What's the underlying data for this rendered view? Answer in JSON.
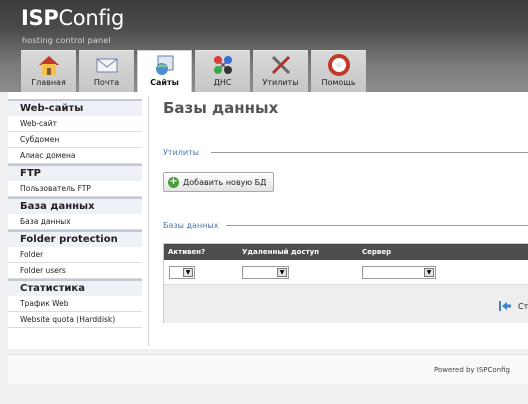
{
  "header": {
    "logo_isp": "ISP",
    "logo_config": "Config",
    "tagline": "hosting control panel"
  },
  "tabs": [
    {
      "label": "Главная",
      "icon": "home-icon"
    },
    {
      "label": "Почта",
      "icon": "mail-icon"
    },
    {
      "label": "Сайты",
      "icon": "sites-icon",
      "active": true
    },
    {
      "label": "ДНС",
      "icon": "dns-icon"
    },
    {
      "label": "Утилиты",
      "icon": "tools-icon"
    },
    {
      "label": "Помощь",
      "icon": "help-icon"
    }
  ],
  "sidebar": {
    "sections": [
      {
        "title": "Web-сайты",
        "items": [
          "Web-сайт",
          "Субдомен",
          "Алиас домена"
        ]
      },
      {
        "title": "FTP",
        "items": [
          "Пользователь FTP"
        ]
      },
      {
        "title": "База данных",
        "items": [
          "База данных"
        ]
      },
      {
        "title": "Folder protection",
        "items": [
          "Folder",
          "Folder users"
        ]
      },
      {
        "title": "Статистика",
        "items": [
          "Трафик Web",
          "Website quota (Harddisk)"
        ]
      }
    ]
  },
  "main": {
    "title": "Базы данных",
    "tools_legend": "Утилиты",
    "add_button": "Добавить новую БД",
    "list_legend": "Базы данных",
    "columns": [
      "Активен?",
      "Удаленный доступ",
      "Сервер"
    ],
    "pager_text": "Ст"
  },
  "footer": {
    "powered": "Powered by ISPConfig"
  }
}
